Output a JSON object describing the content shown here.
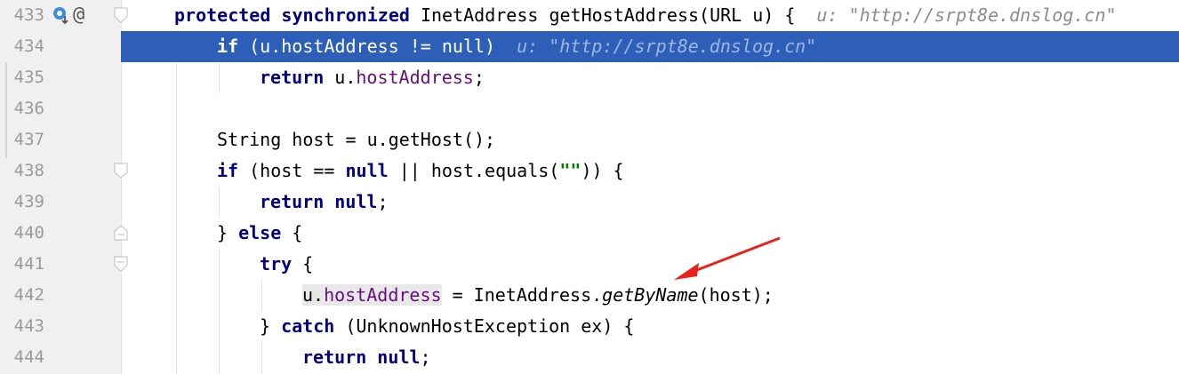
{
  "editor": {
    "lines": [
      {
        "num": "433",
        "hint": "u: \"http://srpt8e.dnslog.cn\""
      },
      {
        "num": "434",
        "hint": "u: \"http://srpt8e.dnslog.cn\""
      },
      {
        "num": "435"
      },
      {
        "num": "436"
      },
      {
        "num": "437"
      },
      {
        "num": "438"
      },
      {
        "num": "439"
      },
      {
        "num": "440"
      },
      {
        "num": "441"
      },
      {
        "num": "442"
      },
      {
        "num": "443"
      },
      {
        "num": "444"
      }
    ],
    "tokens": {
      "protected": "protected",
      "synchronized": "synchronized",
      "sig": " InetAddress getHostAddress(URL u) {",
      "if": "if",
      "cond434": " (u.hostAddress != null)",
      "return": "return",
      "u_dot": "u.",
      "hostAddress": "hostAddress",
      "semi": ";",
      "l437": "String host = u.getHost();",
      "l438a": " (host == ",
      "null": "null",
      "l438b": " || host.equals(",
      "empty_str": "\"\"",
      "l438c": ")) {",
      "else_open": "} ",
      "else": "else",
      "brace": " {",
      "try": "try",
      "l442a": " = InetAddress.",
      "getByName": "getByName",
      "l442b": "(host);",
      "catch_open": "} ",
      "catch": "catch",
      "l443b": " (UnknownHostException ex) {"
    }
  },
  "colors": {
    "selection": "#2d5fb8",
    "keyword": "#000080",
    "field": "#660e7a",
    "string": "#008000",
    "arrow": "#e8221a"
  },
  "icons": [
    "implemented-method-icon",
    "override-annotation-icon",
    "fold-icon",
    "red-arrow-annotation"
  ]
}
